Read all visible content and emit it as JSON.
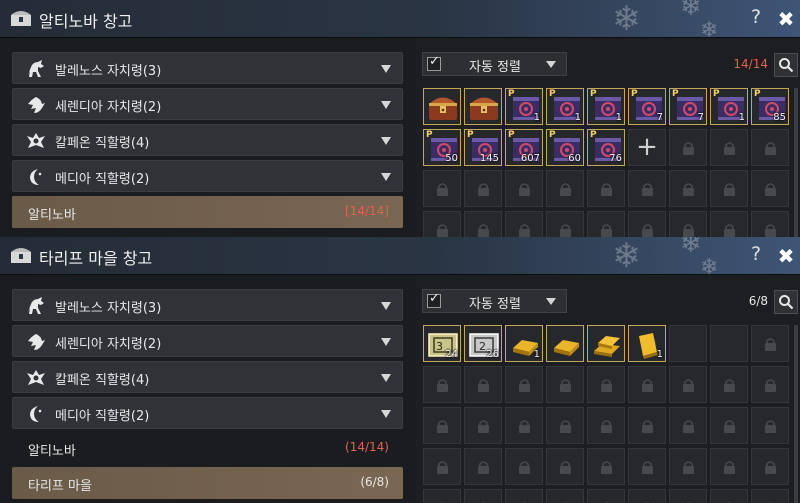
{
  "colors": {
    "accent_red": "#e06450",
    "gold": "#c4a75a",
    "selected_row": "#6a5a48"
  },
  "panels": [
    {
      "title": "알티노바 창고",
      "help_label": "?",
      "close_icon": "close-icon",
      "categories": [
        {
          "label": "발레노스 자치령(3)",
          "icon": "horse-icon"
        },
        {
          "label": "세렌디아 자치령(2)",
          "icon": "eagle-icon"
        },
        {
          "label": "칼페온 직할령(4)",
          "icon": "crest-icon"
        },
        {
          "label": "메디아 직할령(2)",
          "icon": "moon-icon"
        }
      ],
      "subs": [
        {
          "label": "알티노바",
          "count": "[14/14]",
          "selected": true
        }
      ],
      "sort": {
        "checked": "✓",
        "label": "자동 정렬"
      },
      "count": "14/14",
      "count_color": "#e06450",
      "items": [
        {
          "type": "chest",
          "qty": ""
        },
        {
          "type": "chest",
          "qty": ""
        },
        {
          "type": "scroll",
          "qty": "1"
        },
        {
          "type": "scroll",
          "qty": "1"
        },
        {
          "type": "scroll",
          "qty": "1"
        },
        {
          "type": "scroll",
          "qty": "7"
        },
        {
          "type": "scroll",
          "qty": "7"
        },
        {
          "type": "scroll",
          "qty": "1"
        },
        {
          "type": "scroll",
          "qty": "85"
        },
        {
          "type": "scroll",
          "qty": "50"
        },
        {
          "type": "scroll",
          "qty": "145"
        },
        {
          "type": "scroll",
          "qty": "607"
        },
        {
          "type": "scroll",
          "qty": "60"
        },
        {
          "type": "scroll",
          "qty": "76"
        }
      ],
      "plus_label": "+"
    },
    {
      "title": "타리프 마을 창고",
      "help_label": "?",
      "close_icon": "close-icon",
      "categories": [
        {
          "label": "발레노스 자치령(3)",
          "icon": "horse-icon"
        },
        {
          "label": "세렌디아 자치령(2)",
          "icon": "eagle-icon"
        },
        {
          "label": "칼페온 직할령(4)",
          "icon": "crest-icon"
        },
        {
          "label": "메디아 직할령(2)",
          "icon": "moon-icon"
        }
      ],
      "subs": [
        {
          "label": "알티노바",
          "count": "(14/14)",
          "selected": false
        },
        {
          "label": "타리프 마을",
          "count": "(6/8)",
          "selected": true
        }
      ],
      "sort": {
        "checked": "✓",
        "label": "자동 정렬"
      },
      "count": "6/8",
      "count_color": "#e6e6e6",
      "items": [
        {
          "type": "note-gold",
          "qty": "24"
        },
        {
          "type": "note-silver",
          "qty": "26"
        },
        {
          "type": "bar",
          "qty": "1"
        },
        {
          "type": "bar",
          "qty": ""
        },
        {
          "type": "bars",
          "qty": ""
        },
        {
          "type": "bar-single",
          "qty": "1"
        }
      ],
      "plus_label": "+"
    }
  ]
}
